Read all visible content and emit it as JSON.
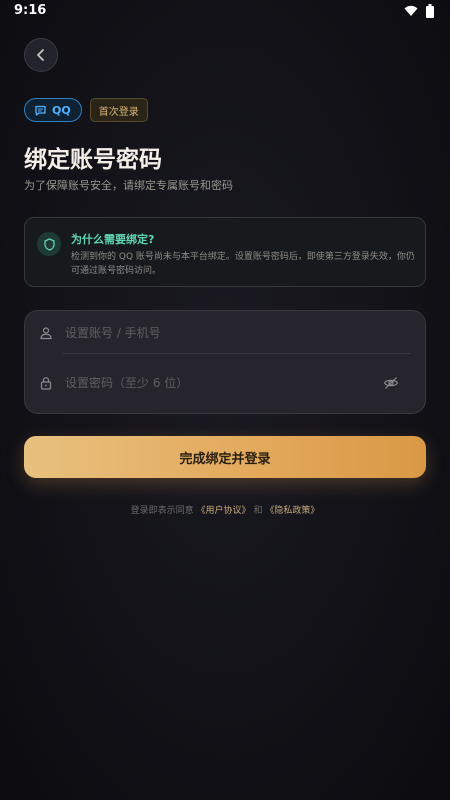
{
  "status_bar": {
    "time": "9:16",
    "icons": [
      "wifi-icon",
      "battery-icon"
    ]
  },
  "header": {
    "back_icon": "chevron-left-icon"
  },
  "badges": {
    "qq_label": "QQ",
    "qq_icon": "chat-icon",
    "first_login": "首次登录"
  },
  "page": {
    "title": "绑定账号密码",
    "subtitle": "为了保障账号安全，请绑定专属账号和密码"
  },
  "info_card": {
    "icon": "shield-icon",
    "title": "为什么需要绑定?",
    "text": "检测到你的 QQ 账号尚未与本平台绑定。设置账号密码后，即使第三方登录失效，你仍可通过账号密码访问。"
  },
  "form": {
    "account_placeholder": "设置账号 / 手机号",
    "account_value": "",
    "password_placeholder": "设置密码（至少 6 位）",
    "password_value": "",
    "user_icon": "user-icon",
    "lock_icon": "lock-icon",
    "eye_icon": "eye-off-icon"
  },
  "submit_label": "完成绑定并登录",
  "agreement": {
    "prefix": "登录即表示同意",
    "terms": "《用户协议》",
    "and": "和",
    "privacy": "《隐私政策》"
  },
  "colors": {
    "accent_gold": "#e3a85a",
    "qq_blue": "#4fb2ff",
    "info_green": "#5fd6b3",
    "background": "#121218"
  }
}
